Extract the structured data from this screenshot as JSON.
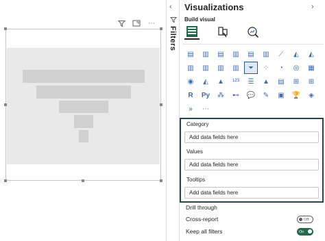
{
  "canvas": {
    "funnel_bars": [
      {
        "name": "funnel-stage-1"
      },
      {
        "name": "funnel-stage-2"
      },
      {
        "name": "funnel-stage-3"
      },
      {
        "name": "funnel-stage-4"
      },
      {
        "name": "funnel-stage-5"
      }
    ],
    "toolbar": {
      "filter_icon": "filter-icon",
      "focus_icon": "focus-mode-icon",
      "more_icon": "more-options-icon",
      "more_glyph": "⋯"
    }
  },
  "filters": {
    "label": "Filters",
    "collapse_glyph": "‹"
  },
  "viz": {
    "title": "Visualizations",
    "collapse_glyph": "›",
    "build_label": "Build visual",
    "more_glyph": "···",
    "icons": [
      "stacked-bar-chart-icon",
      "stacked-column-chart-icon",
      "clustered-bar-chart-icon",
      "clustered-column-chart-icon",
      "100-stacked-bar-chart-icon",
      "100-stacked-column-chart-icon",
      "line-chart-icon",
      "area-chart-icon",
      "stacked-area-chart-icon",
      "line-and-stacked-column-chart-icon",
      "line-and-clustered-column-chart-icon",
      "ribbon-chart-icon",
      "waterfall-chart-icon",
      "funnel-chart-icon",
      "scatter-chart-icon",
      "pie-chart-icon",
      "donut-chart-icon",
      "treemap-icon",
      "map-icon",
      "filled-map-icon",
      "azure-map-icon",
      "card-icon",
      "multi-row-card-icon",
      "kpi-icon",
      "slicer-icon",
      "table-icon",
      "matrix-icon",
      "r-script-visual-icon",
      "python-visual-icon",
      "key-influencers-icon",
      "decomposition-tree-icon",
      "qa-visual-icon",
      "smart-narrative-icon",
      "paginated-report-icon",
      "goals-icon",
      "power-apps-icon",
      "power-automate-icon",
      "more-visuals-icon"
    ],
    "icon_glyphs": [
      "▤",
      "▥",
      "▤",
      "▥",
      "▤",
      "▥",
      "⟋",
      "◭",
      "◭",
      "▥",
      "▥",
      "▥",
      "▥",
      "⏷",
      "⁘",
      "◔",
      "◎",
      "▦",
      "◉",
      "◭",
      "▲",
      "¹²³",
      "☰",
      "▲",
      "▤",
      "⊞",
      "⊞",
      "R",
      "Py",
      "⁂",
      "⊷",
      "💬",
      "✎",
      "▣",
      "🏆",
      "◈",
      "»",
      "⋯"
    ],
    "wells": [
      {
        "label": "Category",
        "placeholder": "Add data fields here"
      },
      {
        "label": "Values",
        "placeholder": "Add data fields here"
      },
      {
        "label": "Tooltips",
        "placeholder": "Add data fields here"
      }
    ],
    "drill": {
      "title": "Drill through",
      "cross_report_label": "Cross-report",
      "cross_report_state": "Off",
      "keep_filters_label": "Keep all filters",
      "keep_filters_state": "On"
    }
  },
  "colors": {
    "accent": "#2b579a",
    "wells_border": "#1e4950",
    "toggle_on": "#1f6b4a"
  }
}
